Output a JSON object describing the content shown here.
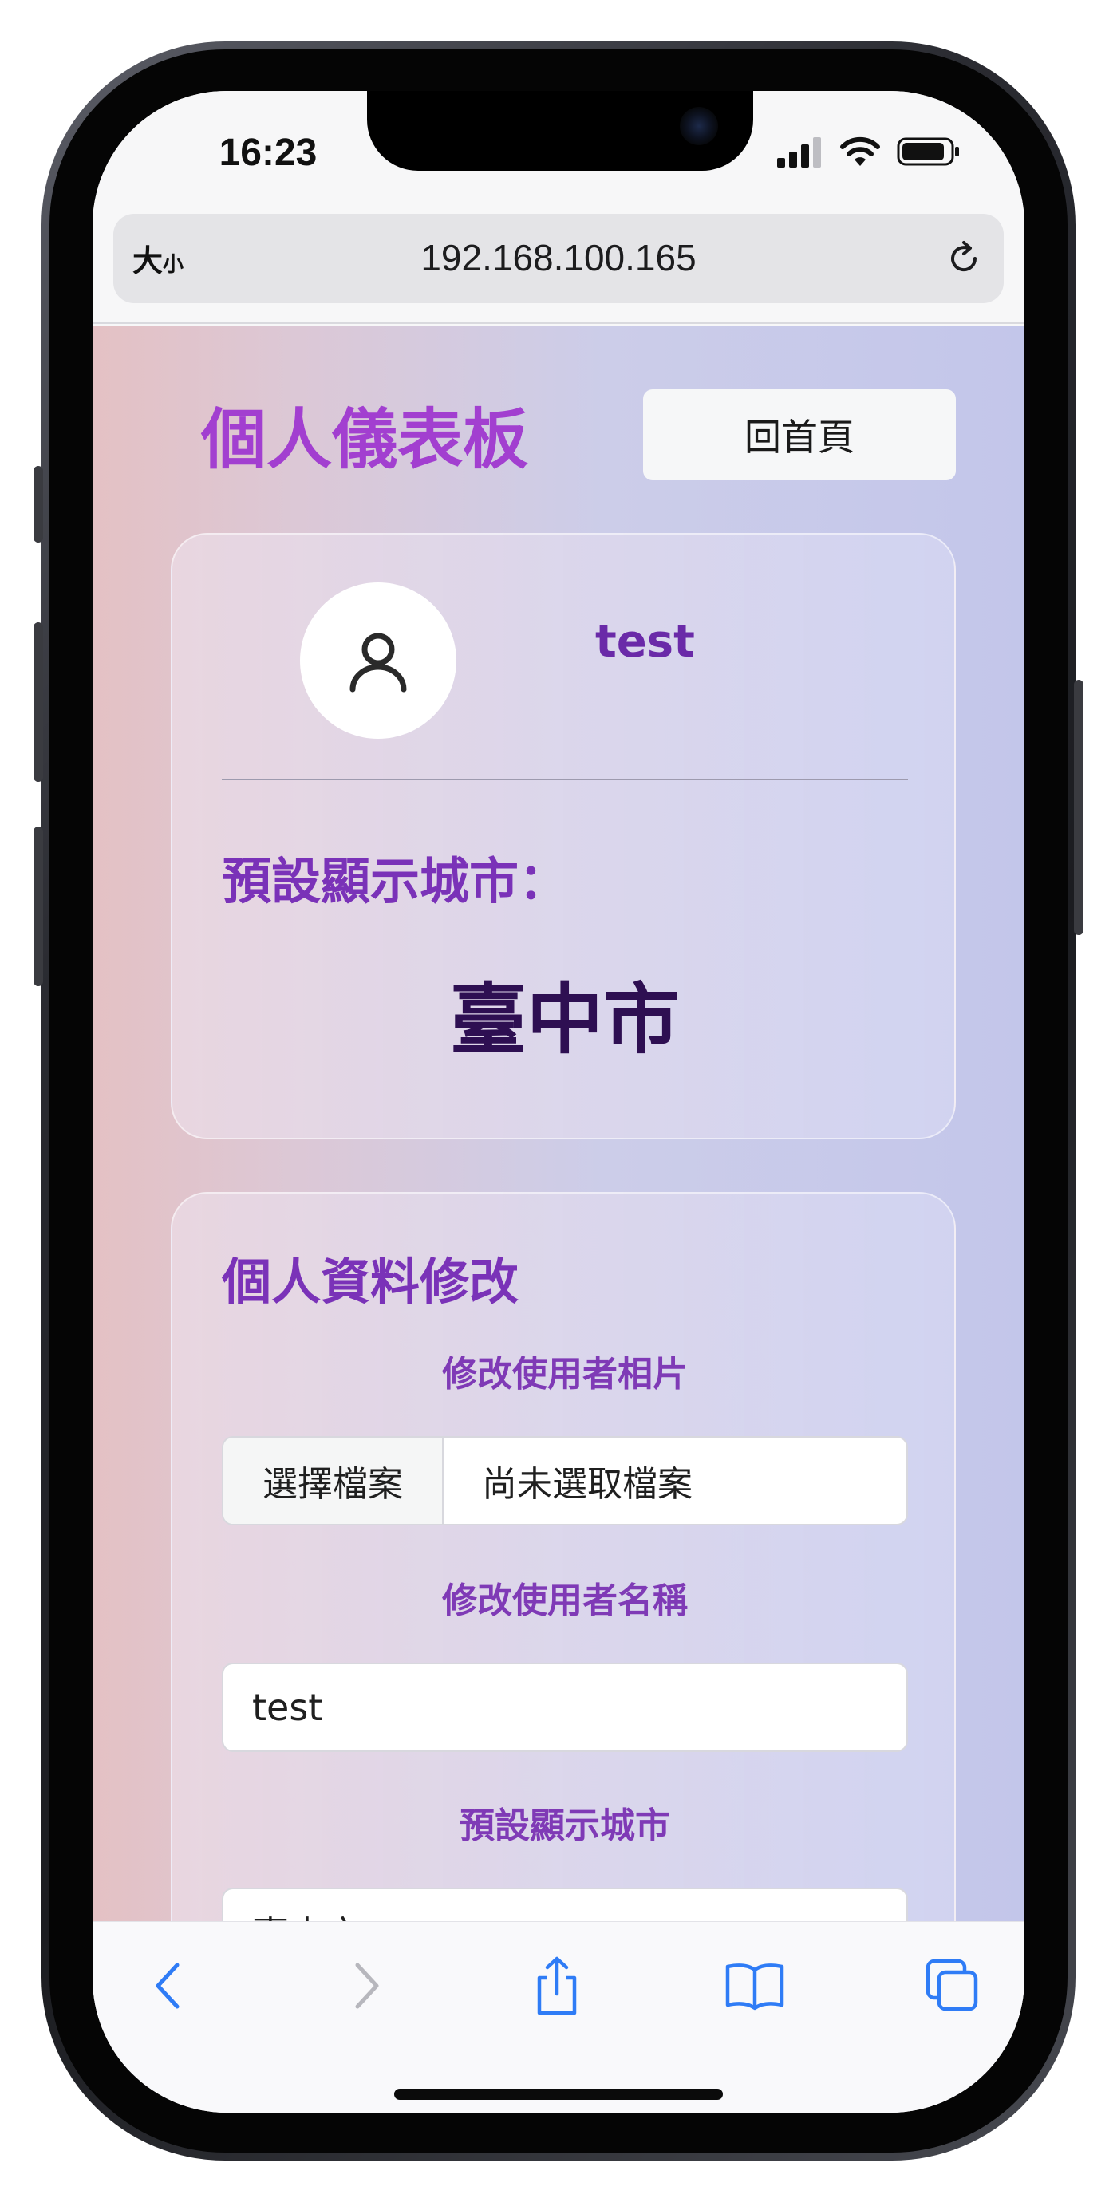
{
  "status_bar": {
    "time": "16:23",
    "icons": [
      "cellular-signal-icon",
      "wifi-icon",
      "battery-icon"
    ]
  },
  "browser": {
    "text_size_big": "大",
    "text_size_small": "小",
    "url": "192.168.100.165",
    "reload_icon": "reload-icon"
  },
  "page": {
    "title": "個人儀表板",
    "home_button": "回首頁"
  },
  "profile": {
    "avatar_icon": "user-icon",
    "username": "test",
    "city_label": "預設顯示城市：",
    "city_value": "臺中市"
  },
  "edit": {
    "title": "個人資料修改",
    "photo_label": "修改使用者相片",
    "file_button": "選擇檔案",
    "file_status": "尚未選取檔案",
    "name_label": "修改使用者名稱",
    "name_value": "test",
    "city_label": "預設顯示城市",
    "city_value": "臺中市"
  },
  "toolbar": {
    "items": [
      "back-icon",
      "forward-icon",
      "share-icon",
      "bookmarks-icon",
      "tabs-icon"
    ]
  },
  "colors": {
    "title_purple": "#a23fd0",
    "label_purple": "#7a32b8",
    "city_dark": "#2e0f52",
    "browser_blue": "#2f7cf6"
  }
}
